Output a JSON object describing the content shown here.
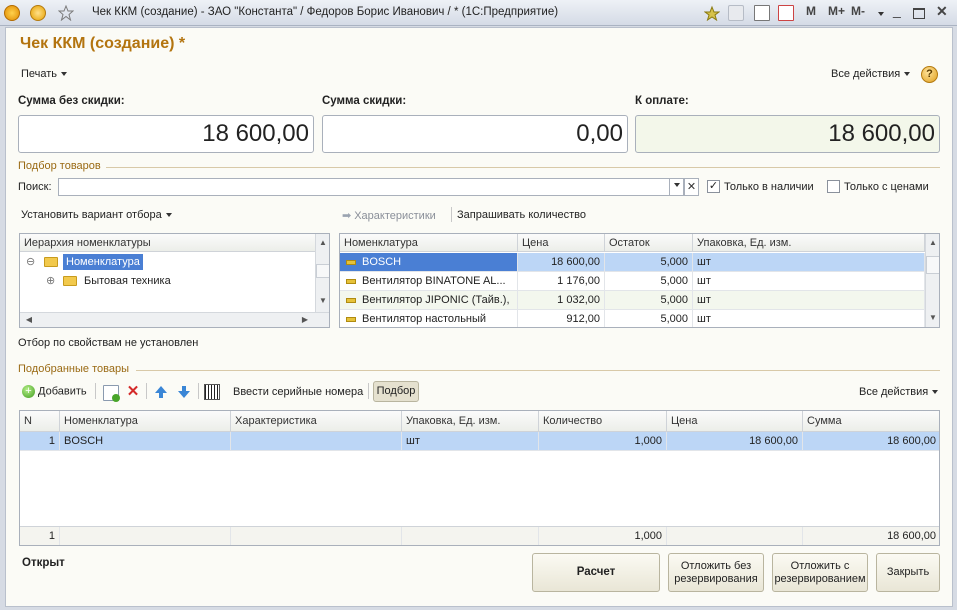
{
  "window": {
    "title": "Чек ККМ (создание) - ЗАО \"Константа\" / Федоров Борис Иванович / * (1С:Предприятие)",
    "right_buttons": [
      "M",
      "M+",
      "M-"
    ]
  },
  "form": {
    "title": "Чек ККМ (создание) *",
    "print_label": "Печать",
    "all_actions_label": "Все действия",
    "help": "?"
  },
  "sums": {
    "no_discount_label": "Сумма без скидки:",
    "no_discount_value": "18 600,00",
    "discount_label": "Сумма скидки:",
    "discount_value": "0,00",
    "to_pay_label": "К оплате:",
    "to_pay_value": "18 600,00"
  },
  "selection": {
    "group_title": "Подбор товаров",
    "search_label": "Поиск:",
    "search_value": "",
    "only_in_stock_label": "Только в наличии",
    "only_in_stock_checked": true,
    "only_with_prices_label": "Только с ценами",
    "only_with_prices_checked": false,
    "filter_variant_label": "Установить вариант отбора",
    "characteristics_label": "Характеристики",
    "ask_quantity_label": "Запрашивать количество",
    "filter_status": "Отбор по свойствам не установлен"
  },
  "hierarchy": {
    "header": "Иерархия номенклатуры",
    "items": [
      {
        "label": "Номенклатура",
        "toggle": "⊖"
      },
      {
        "label": "Бытовая техника",
        "toggle": "⊕"
      }
    ]
  },
  "products": {
    "headers": [
      "Номенклатура",
      "Цена",
      "Остаток",
      "Упаковка, Ед. изм."
    ],
    "rows": [
      {
        "name": "BOSCH",
        "price": "18 600,00",
        "stock": "5,000",
        "unit": "шт"
      },
      {
        "name": "Вентилятор BINATONE AL...",
        "price": "1 176,00",
        "stock": "5,000",
        "unit": "шт"
      },
      {
        "name": "Вентилятор JIPONIC (Тайв.),",
        "price": "1 032,00",
        "stock": "5,000",
        "unit": "шт"
      },
      {
        "name": "Вентилятор настольный",
        "price": "912,00",
        "stock": "5,000",
        "unit": "шт"
      }
    ]
  },
  "selected": {
    "group_title": "Подобранные товары",
    "add_label": "Добавить",
    "serial_label": "Ввести серийные номера",
    "pick_label": "Подбор",
    "all_actions_label": "Все действия",
    "headers": [
      "N",
      "Номенклатура",
      "Характеристика",
      "Упаковка, Ед. изм.",
      "Количество",
      "Цена",
      "Сумма"
    ],
    "rows": [
      {
        "n": "1",
        "name": "BOSCH",
        "char": "",
        "unit": "шт",
        "qty": "1,000",
        "price": "18 600,00",
        "sum": "18 600,00"
      }
    ],
    "footer": {
      "n": "1",
      "qty": "1,000",
      "sum": "18 600,00"
    }
  },
  "bottom": {
    "status": "Открыт",
    "calc": "Расчет",
    "defer_no_reserve_1": "Отложить без",
    "defer_no_reserve_2": "резервирования",
    "defer_reserve_1": "Отложить с",
    "defer_reserve_2": "резервированием",
    "close": "Закрыть"
  }
}
